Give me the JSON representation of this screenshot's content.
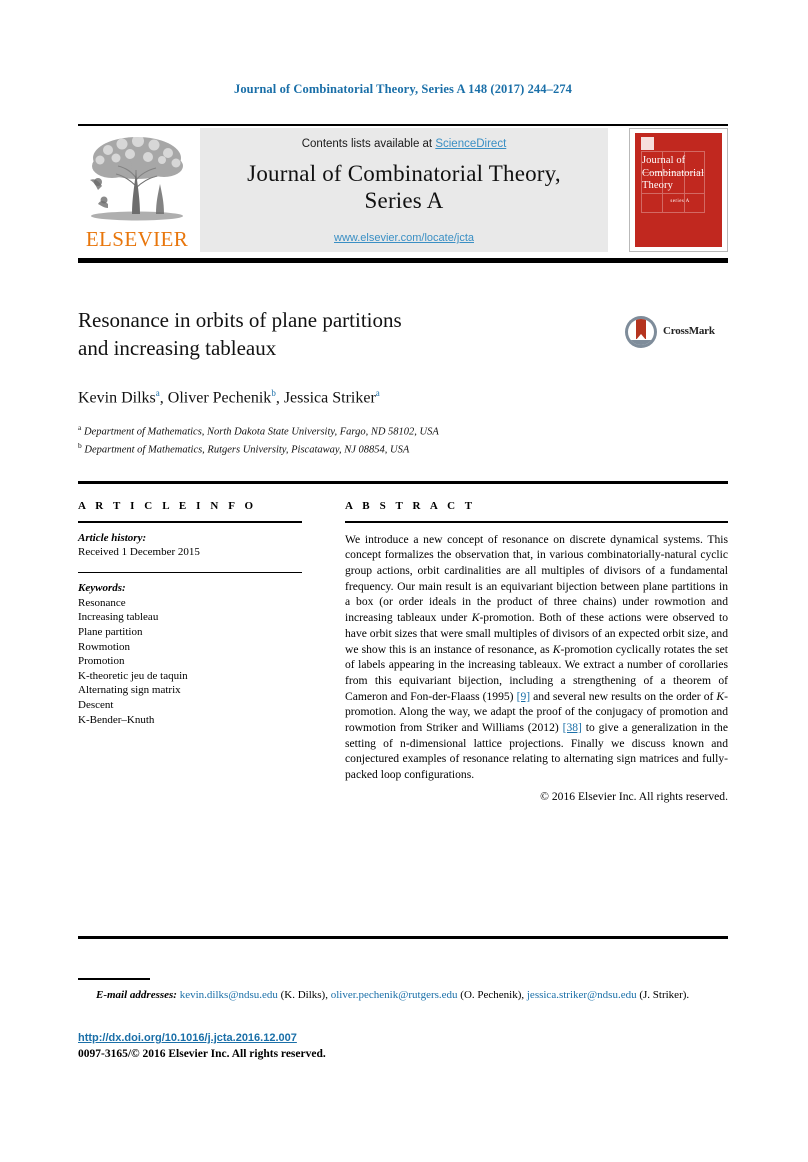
{
  "running_head": "Journal of Combinatorial Theory, Series A 148 (2017) 244–274",
  "masthead": {
    "publisher_logo_label": "ELSEVIER",
    "contents_prefix": "Contents lists available at ",
    "contents_link": "ScienceDirect",
    "journal_title_line1": "Journal of Combinatorial Theory,",
    "journal_title_line2": "Series A",
    "journal_url": "www.elsevier.com/locate/jcta",
    "cover": {
      "title_line1": "Journal of",
      "title_line2": "Combinatorial",
      "title_line3": "Theory",
      "series_label": "series A",
      "background_color": "#c1281f"
    }
  },
  "article": {
    "title_line1": "Resonance in orbits of plane partitions",
    "title_line2": "and increasing tableaux",
    "crossmark_label": "CrossMark",
    "authors": [
      {
        "name": "Kevin Dilks",
        "marker": "a"
      },
      {
        "name": "Oliver Pechenik",
        "marker": "b"
      },
      {
        "name": "Jessica Striker",
        "marker": "a"
      }
    ],
    "affiliations": [
      {
        "marker": "a",
        "text": "Department of Mathematics, North Dakota State University, Fargo, ND 58102, USA"
      },
      {
        "marker": "b",
        "text": "Department of Mathematics, Rutgers University, Piscataway, NJ 08854, USA"
      }
    ]
  },
  "info": {
    "heading": "A R T I C L E   I N F O",
    "history_label": "Article history:",
    "history_received": "Received 1 December 2015",
    "keywords_label": "Keywords:",
    "keywords": [
      "Resonance",
      "Increasing tableau",
      "Plane partition",
      "Rowmotion",
      "Promotion",
      "K-theoretic jeu de taquin",
      "Alternating sign matrix",
      "Descent",
      "K-Bender–Knuth"
    ]
  },
  "abstract": {
    "heading": "A B S T R A C T",
    "part1": "We introduce a new concept of resonance on discrete dynamical systems. This concept formalizes the observation that, in various combinatorially-natural cyclic group actions, orbit cardinalities are all multiples of divisors of a fundamental frequency. Our main result is an equivariant bijection between plane partitions in a box (or order ideals in the product of three chains) under rowmotion and increasing tableaux under ",
    "italic1": "K",
    "part2": "-promotion. Both of these actions were observed to have orbit sizes that were small multiples of divisors of an expected orbit size, and we show this is an instance of resonance, as ",
    "italic2": "K",
    "part3": "-promotion cyclically rotates the set of labels appearing in the increasing tableaux. We extract a number of corollaries from this equivariant bijection, including a strengthening of a theorem of Cameron and Fon-der-Flaass (1995) ",
    "cite1": "[9]",
    "part4": " and several new results on the order of ",
    "italic3": "K",
    "part5": "-promotion. Along the way, we adapt the proof of the conjugacy of promotion and rowmotion from Striker and Williams (2012) ",
    "cite2": "[38]",
    "part6": " to give a generalization in the setting of n-dimensional lattice projections. Finally we discuss known and conjectured examples of resonance relating to alternating sign matrices and fully-packed loop configurations.",
    "copyright": "© 2016 Elsevier Inc. All rights reserved."
  },
  "footer": {
    "emails_label": "E-mail addresses:",
    "emails": [
      {
        "address": "kevin.dilks@ndsu.edu",
        "person": "(K. Dilks)"
      },
      {
        "address": "oliver.pechenik@rutgers.edu",
        "person": "(O. Pechenik)"
      },
      {
        "address": "jessica.striker@ndsu.edu",
        "person": "(J. Striker)"
      }
    ],
    "doi": "http://dx.doi.org/10.1016/j.jcta.2016.12.007",
    "issn_line": "0097-3165/© 2016 Elsevier Inc. All rights reserved."
  }
}
